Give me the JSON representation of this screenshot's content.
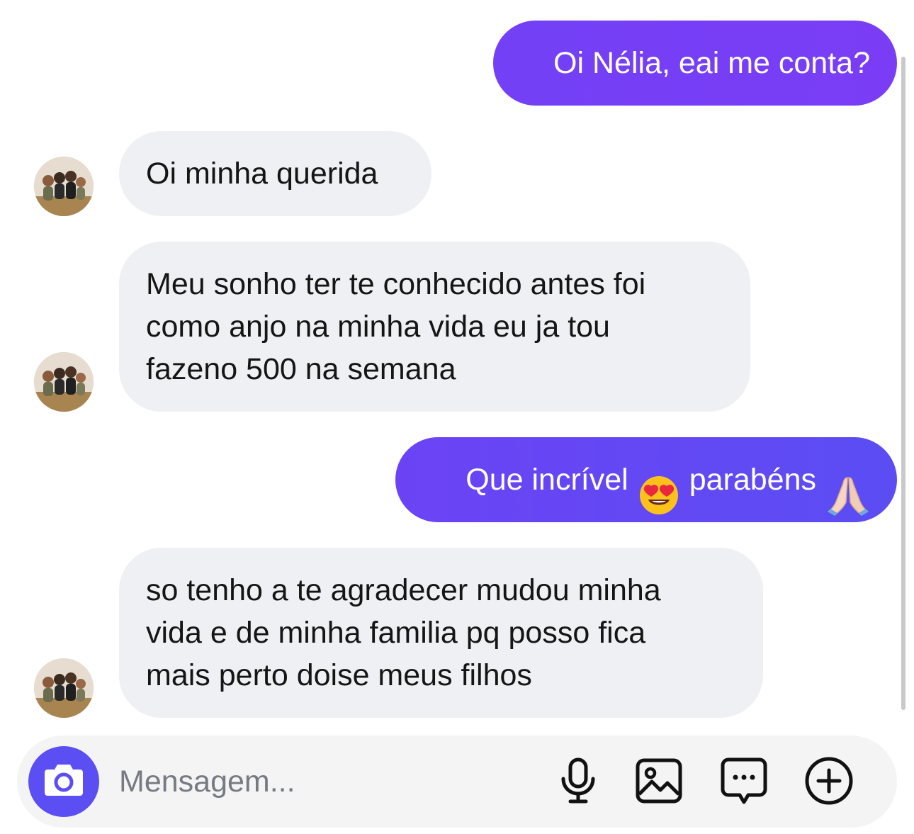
{
  "messages": [
    {
      "side": "out",
      "text": "Oi Nélia, eai me conta?"
    },
    {
      "side": "in",
      "text": "Oi minha querida"
    },
    {
      "side": "in",
      "text": "Meu sonho ter te conhecido antes foi\ncomo anjo na minha vida eu ja tou\nfazeno 500 na semana"
    },
    {
      "side": "out",
      "text_before": "Que incrível",
      "emoji_1": "heart-eyes-emoji",
      "text_middle": "parabéns",
      "emoji_2": "praying-hands-emoji"
    },
    {
      "side": "in",
      "text": "so tenho a te agradecer mudou minha\nvida e de minha familia pq posso fica\nmais perto doise meus filhos"
    }
  ],
  "composer": {
    "placeholder": "Mensagem...",
    "camera_icon": "camera-icon",
    "tools": [
      "microphone-icon",
      "image-icon",
      "chat-bubble-icon",
      "plus-circle-icon"
    ]
  },
  "colors": {
    "outgoing_bubble": "#7340f6",
    "outgoing_bubble_alt": "#5b4df3",
    "incoming_bubble": "#eff0f4",
    "camera_button": "#5b4ef3",
    "composer_bg": "#f4f4f5"
  }
}
